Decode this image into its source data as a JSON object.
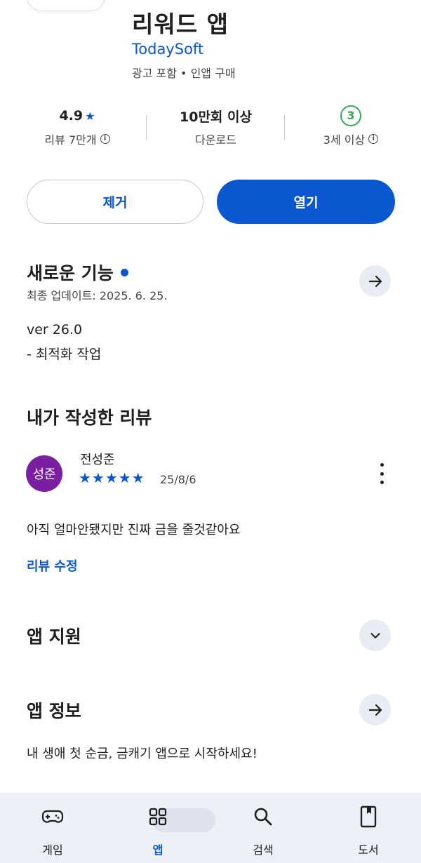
{
  "app": {
    "title": "리워드 앱",
    "developer": "TodaySoft",
    "ad_info": "광고 포함 • 인앱 구매"
  },
  "stats": {
    "rating": "4.9",
    "rating_label": "리뷰 7만개",
    "downloads": "10만회 이상",
    "downloads_label": "다운로드",
    "age_badge": "3",
    "age_label": "3세 이상"
  },
  "buttons": {
    "remove": "제거",
    "open": "열기"
  },
  "whats_new": {
    "title": "새로운 기능",
    "updated": "최종 업데이트: 2025. 6. 25.",
    "version": "ver 26.0",
    "notes": "- 최적화 작업"
  },
  "my_review": {
    "title": "내가 작성한 리뷰",
    "avatar_text": "성준",
    "reviewer": "전성준",
    "stars": "★★★★★",
    "rating": 5,
    "date": "25/8/6",
    "text": "아직 얼마안됐지만 진짜 금을 줄것같아요",
    "edit_link": "리뷰 수정"
  },
  "app_support": {
    "title": "앱 지원"
  },
  "app_info": {
    "title": "앱 정보",
    "description": "내 생애 첫 순금, 금캐기 앱으로 시작하세요!"
  },
  "bottom_nav": {
    "items": [
      {
        "label": "게임",
        "icon": "gamepad-icon"
      },
      {
        "label": "앱",
        "icon": "apps-grid-icon"
      },
      {
        "label": "검색",
        "icon": "search-icon"
      },
      {
        "label": "도서",
        "icon": "book-icon"
      }
    ],
    "active_index": 1
  },
  "colors": {
    "accent": "#0b57d0",
    "avatar": "#7b1fa2",
    "age_badge": "#34a853",
    "nav_background": "#edf0f6"
  }
}
